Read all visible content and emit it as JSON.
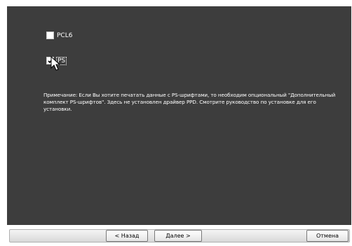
{
  "options": [
    {
      "label": "PCL6",
      "checked": false
    },
    {
      "label": "PS",
      "checked": true
    }
  ],
  "note": "Примечание: Если Вы хотите печатать данные с PS-шрифтами, то необходим опциональный \"Дополнительный комплект PS-шрифтов\". Здесь не установлен драйвер PPD. Смотрите руководство по установке для его установки.",
  "buttons": {
    "back": "< Назад",
    "next": "Далее >",
    "cancel": "Отмена"
  },
  "colors": {
    "panel": "#3d3d3d",
    "text": "#ffffff"
  }
}
